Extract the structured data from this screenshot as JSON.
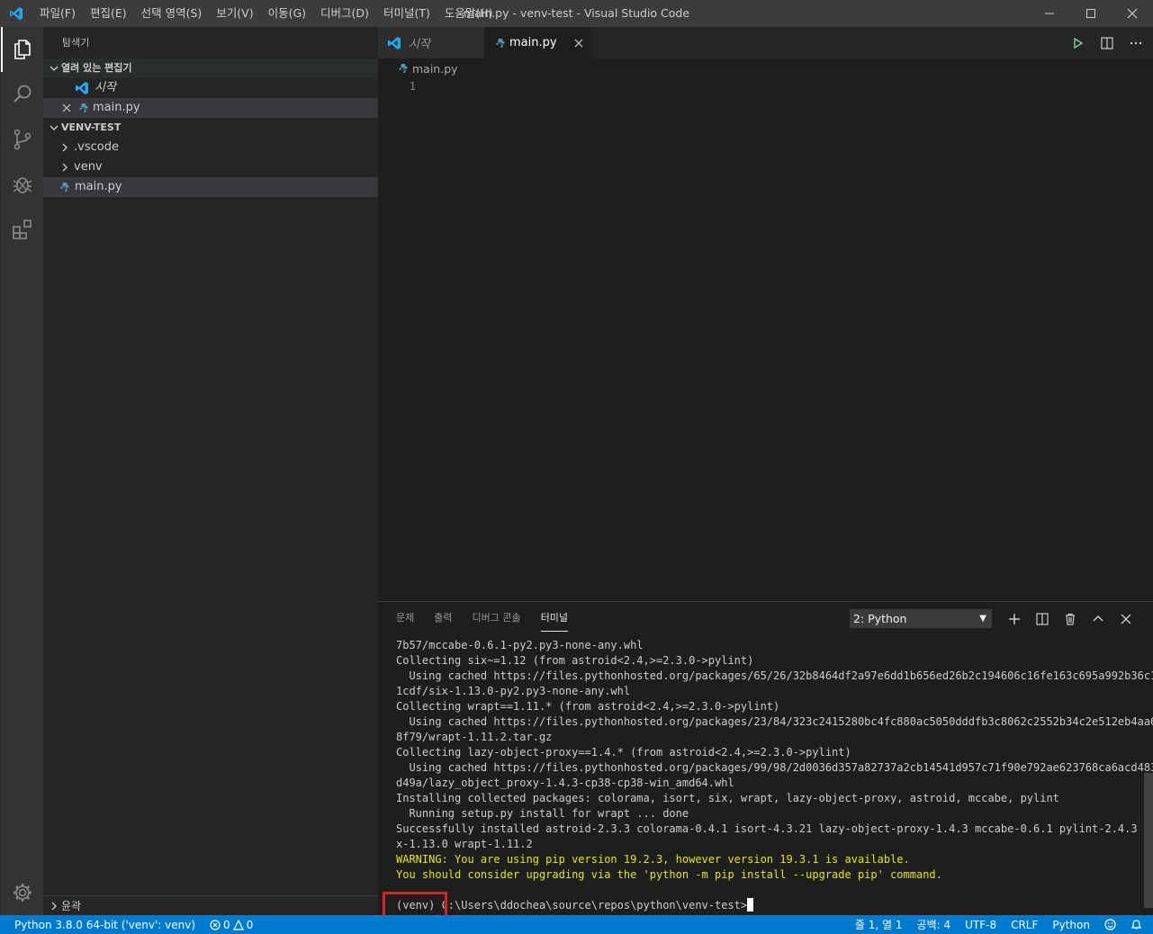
{
  "window": {
    "title": "main.py - venv-test - Visual Studio Code"
  },
  "menu": [
    "파일(F)",
    "편집(E)",
    "선택 영역(S)",
    "보기(V)",
    "이동(G)",
    "디버그(D)",
    "터미널(T)",
    "도움말(H)"
  ],
  "sidebar": {
    "title": "탐색기",
    "open_editors_header": "열려 있는 편집기",
    "open_editors": [
      {
        "label": "시작"
      },
      {
        "label": "main.py"
      }
    ],
    "folder_header": "VENV-TEST",
    "folder_items": [
      {
        "label": ".vscode"
      },
      {
        "label": "venv"
      },
      {
        "label": "main.py"
      }
    ],
    "outline_header": "윤곽"
  },
  "tabs": [
    {
      "label": "시작"
    },
    {
      "label": "main.py"
    }
  ],
  "breadcrumb": "main.py",
  "editor": {
    "line_number": "1"
  },
  "panel": {
    "tabs": [
      "문제",
      "출력",
      "디버그 콘솔",
      "터미널"
    ],
    "terminal_selector": "2: Python",
    "terminal_lines": [
      {
        "text": "7b57/mccabe-0.6.1-py2.py3-none-any.whl",
        "type": "normal"
      },
      {
        "text": "Collecting six~=1.12 (from astroid<2.4,>=2.3.0->pylint)",
        "type": "normal"
      },
      {
        "text": "  Using cached https://files.pythonhosted.org/packages/65/26/32b8464df2a97e6dd1b656ed26b2c194606c16fe163c695a992b36c1",
        "type": "normal"
      },
      {
        "text": "1cdf/six-1.13.0-py2.py3-none-any.whl",
        "type": "normal"
      },
      {
        "text": "Collecting wrapt==1.11.* (from astroid<2.4,>=2.3.0->pylint)",
        "type": "normal"
      },
      {
        "text": "  Using cached https://files.pythonhosted.org/packages/23/84/323c2415280bc4fc880ac5050dddfb3c8062c2552b34c2e512eb4aa6",
        "type": "normal"
      },
      {
        "text": "8f79/wrapt-1.11.2.tar.gz",
        "type": "normal"
      },
      {
        "text": "Collecting lazy-object-proxy==1.4.* (from astroid<2.4,>=2.3.0->pylint)",
        "type": "normal"
      },
      {
        "text": "  Using cached https://files.pythonhosted.org/packages/99/98/2d0036d357a82737a2cb14541d957c71f90e792ae623768ca6acd483",
        "type": "normal"
      },
      {
        "text": "d49a/lazy_object_proxy-1.4.3-cp38-cp38-win_amd64.whl",
        "type": "normal"
      },
      {
        "text": "Installing collected packages: colorama, isort, six, wrapt, lazy-object-proxy, astroid, mccabe, pylint",
        "type": "normal"
      },
      {
        "text": "  Running setup.py install for wrapt ... done",
        "type": "normal"
      },
      {
        "text": "Successfully installed astroid-2.3.3 colorama-0.4.1 isort-4.3.21 lazy-object-proxy-1.4.3 mccabe-0.6.1 pylint-2.4.3 si",
        "type": "normal"
      },
      {
        "text": "x-1.13.0 wrapt-1.11.2",
        "type": "normal"
      },
      {
        "text": "WARNING: You are using pip version 19.2.3, however version 19.3.1 is available.",
        "type": "warn"
      },
      {
        "text": "You should consider upgrading via the 'python -m pip install --upgrade pip' command.",
        "type": "warn"
      },
      {
        "text": "",
        "type": "normal"
      }
    ],
    "prompt": "(venv) C:\\Users\\ddochea\\source\\repos\\python\\venv-test>"
  },
  "statusbar": {
    "interpreter": "Python 3.8.0 64-bit ('venv': venv)",
    "errors": "0",
    "warnings": "0",
    "position": "줄 1, 열 1",
    "spaces": "공백: 4",
    "encoding": "UTF-8",
    "eol": "CRLF",
    "language": "Python"
  },
  "colors": {
    "accent": "#007acc",
    "warning_text": "#e5e510",
    "highlight_box": "#e02020"
  }
}
